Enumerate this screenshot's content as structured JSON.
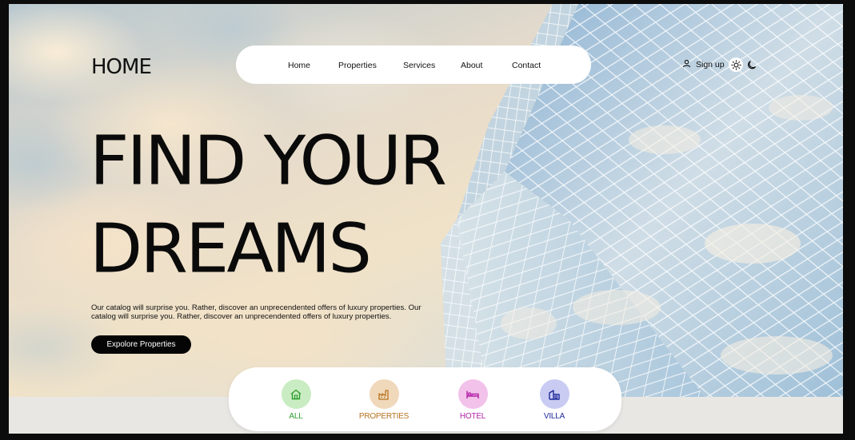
{
  "brand": {
    "logo_text": "HOME"
  },
  "nav": {
    "items": [
      {
        "label": "Home"
      },
      {
        "label": "Properties"
      },
      {
        "label": "Services"
      },
      {
        "label": "About"
      },
      {
        "label": "Contact"
      }
    ]
  },
  "account": {
    "signup_label": "Sign up",
    "user_icon": "user-icon",
    "light_icon": "sun-icon",
    "dark_icon": "moon-icon"
  },
  "hero": {
    "headline_line1": "FIND YOUR",
    "headline_line2": "DREAMS",
    "description": "Our catalog will surprise you. Rather, discover an unprecendented offers of luxury properties. Our catalog will surprise you. Rather, discover an unprecendented offers of luxury properties.",
    "cta_label": "Expolore Properties"
  },
  "categories": [
    {
      "label": "ALL",
      "icon": "house-icon",
      "color": "#2e9e2e",
      "bg": "#c9ecc2"
    },
    {
      "label": "PROPERTIES",
      "icon": "factory-icon",
      "color": "#b5731e",
      "bg": "#f0d8bb"
    },
    {
      "label": "HOTEL",
      "icon": "bed-icon",
      "color": "#b323a8",
      "bg": "#f2c2ea"
    },
    {
      "label": "VILLA",
      "icon": "building-icon",
      "color": "#1f2a9a",
      "bg": "#c9cbf3"
    }
  ]
}
